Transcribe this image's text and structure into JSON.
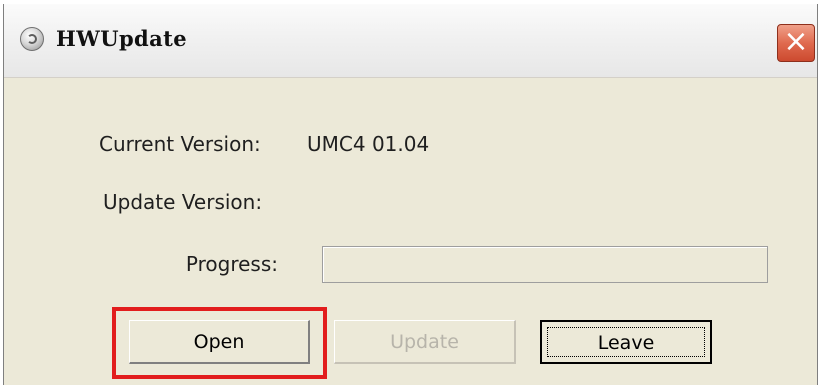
{
  "window": {
    "title": "HWUpdate",
    "close_icon": "close-icon",
    "app_icon": "app-icon"
  },
  "fields": {
    "current_version_label": "Current Version:",
    "current_version_value": "UMC4 01.04",
    "update_version_label": "Update Version:",
    "update_version_value": "",
    "progress_label": "Progress:",
    "progress_value": 0
  },
  "buttons": {
    "open_label": "Open",
    "update_label": "Update",
    "leave_label": "Leave"
  },
  "colors": {
    "highlight": "#e21d1d",
    "disabled_text": "#b7b4aa"
  }
}
